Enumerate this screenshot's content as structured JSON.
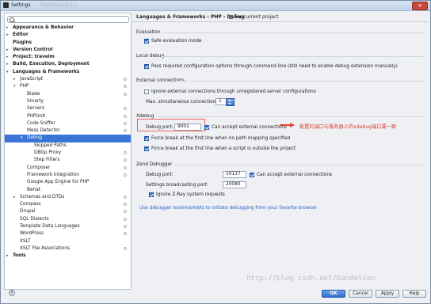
{
  "window": {
    "title": "Settings",
    "subtitle": "- PhpStorm 8.0.1",
    "close_label": "✕"
  },
  "search": {
    "placeholder": "",
    "value": ""
  },
  "tree": [
    {
      "label": "Appearance & Behavior",
      "level": 0,
      "arrow": "▸",
      "bold": true
    },
    {
      "label": "Editor",
      "level": 0,
      "arrow": "▸",
      "bold": true
    },
    {
      "label": "Plugins",
      "level": 0,
      "arrow": "",
      "bold": true
    },
    {
      "label": "Version Control",
      "level": 0,
      "arrow": "▸",
      "bold": true
    },
    {
      "label": "Project: travelm",
      "level": 0,
      "arrow": "▸",
      "bold": true
    },
    {
      "label": "Build, Execution, Deployment",
      "level": 0,
      "arrow": "▸",
      "bold": true
    },
    {
      "label": "Languages & Frameworks",
      "level": 0,
      "arrow": "▾",
      "bold": true
    },
    {
      "label": "JavaScript",
      "level": 1,
      "arrow": "▸",
      "proj": true
    },
    {
      "label": "PHP",
      "level": 1,
      "arrow": "▾",
      "proj": true
    },
    {
      "label": "Blade",
      "level": 2,
      "arrow": "",
      "proj": true
    },
    {
      "label": "Smarty",
      "level": 2,
      "arrow": ""
    },
    {
      "label": "Servers",
      "level": 2,
      "arrow": "",
      "proj": true
    },
    {
      "label": "PHPUnit",
      "level": 2,
      "arrow": "",
      "proj": true
    },
    {
      "label": "Code Sniffer",
      "level": 2,
      "arrow": "",
      "proj": true
    },
    {
      "label": "Mess Detector",
      "level": 2,
      "arrow": "",
      "proj": true
    },
    {
      "label": "Debug",
      "level": 2,
      "arrow": "▾",
      "selected": true
    },
    {
      "label": "Skipped Paths",
      "level": 3,
      "arrow": ""
    },
    {
      "label": "DBGp Proxy",
      "level": 3,
      "arrow": "",
      "proj": true
    },
    {
      "label": "Step Filters",
      "level": 3,
      "arrow": "",
      "proj": true
    },
    {
      "label": "Composer",
      "level": 2,
      "arrow": "",
      "proj": true
    },
    {
      "label": "Framework Integration",
      "level": 2,
      "arrow": "",
      "proj": true
    },
    {
      "label": "Google App Engine for PHP",
      "level": 2,
      "arrow": ""
    },
    {
      "label": "Behat",
      "level": 2,
      "arrow": ""
    },
    {
      "label": "Schemas and DTDs",
      "level": 1,
      "arrow": "▸",
      "proj": true
    },
    {
      "label": "Compass",
      "level": 1,
      "arrow": "",
      "proj": true
    },
    {
      "label": "Drupal",
      "level": 1,
      "arrow": "",
      "proj": true
    },
    {
      "label": "SQL Dialects",
      "level": 1,
      "arrow": "",
      "proj": true
    },
    {
      "label": "Template Data Languages",
      "level": 1,
      "arrow": "",
      "proj": true
    },
    {
      "label": "WordPress",
      "level": 1,
      "arrow": "",
      "proj": true
    },
    {
      "label": "XSLT",
      "level": 1,
      "arrow": ""
    },
    {
      "label": "XSLT File Associations",
      "level": 1,
      "arrow": "",
      "proj": true
    },
    {
      "label": "Tools",
      "level": 0,
      "arrow": "▸",
      "bold": true
    }
  ],
  "header": {
    "breadcrumb": "Languages & Frameworks › PHP › Debug",
    "scope": "For current project"
  },
  "evaluation": {
    "title": "Evaluation",
    "safe_eval": "Safe evaluation mode"
  },
  "local_debug": {
    "title": "Local debug",
    "pass_config": "Pass required configuration options through command line (still need to enable debug extension manually)"
  },
  "external": {
    "title": "External connections",
    "ignore": "Ignore external connections through unregistered server configurations",
    "max_label": "Max. simultaneous connections:",
    "max_value": "1"
  },
  "xdebug": {
    "title": "Xdebug",
    "port_label": "Debug port:",
    "port_value": "9001",
    "accept": "Can accept external connections",
    "force_break_path": "Force break at the first line when no path mapping specified",
    "force_break_outside": "Force break at the first line when a script is outside the project"
  },
  "annotation": "配置的端口与服务器上的xdebug端口要一致",
  "zend": {
    "title": "Zend Debugger",
    "port_label": "Debug port:",
    "port_value": "10137",
    "accept": "Can accept external connections",
    "broadcast_label": "Settings broadcasting port:",
    "broadcast_value": "20080",
    "ignore_zray": "Ignore Z-Ray system requests"
  },
  "bookmarklets_link": "Use debugger bookmarklets to initiate debugging from your favorite browser",
  "buttons": {
    "ok": "OK",
    "cancel": "Cancel",
    "apply": "Apply",
    "help": "Help"
  },
  "watermark": "http://blog.csdn.net/Dandelion",
  "colors": {
    "selection": "#3875d7",
    "link": "#2a5fd1",
    "annotation": "#e33a29"
  }
}
